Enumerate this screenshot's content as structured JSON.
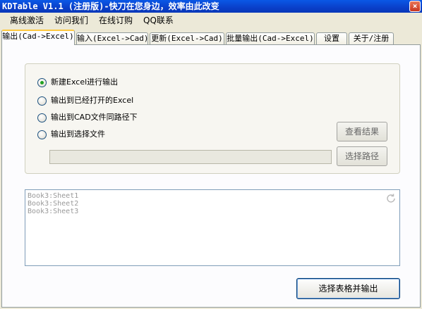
{
  "window": {
    "title": "KDTable V1.1 (注册版)-快刀在您身边，效率由此改变",
    "close_label": "×"
  },
  "menu": [
    {
      "label": "离线激活"
    },
    {
      "label": "访问我们"
    },
    {
      "label": "在线订购"
    },
    {
      "label": "QQ联系"
    }
  ],
  "tabs": [
    {
      "label": "输出(Cad->Excel)",
      "active": true
    },
    {
      "label": "输入(Excel->Cad)"
    },
    {
      "label": "更新(Excel->Cad)"
    },
    {
      "label": "批量输出(Cad->Excel)"
    },
    {
      "label": "设置"
    },
    {
      "label": "关于/注册"
    }
  ],
  "output_options": {
    "options": [
      {
        "label": "新建Excel进行输出",
        "checked": true
      },
      {
        "label": "输出到已经打开的Excel",
        "checked": false
      },
      {
        "label": "输出到CAD文件同路径下",
        "checked": false
      },
      {
        "label": "输出到选择文件",
        "checked": false
      }
    ],
    "path_value": "",
    "view_result_label": "查看结果",
    "choose_path_label": "选择路径"
  },
  "sheets": [
    "Book3:Sheet1",
    "Book3:Sheet2",
    "Book3:Sheet3"
  ],
  "export_button_label": "选择表格并输出",
  "colors": {
    "title_bar": "#0a3fc9",
    "active_tab_accent": "#ffc83c",
    "radio_dot": "#21a121"
  }
}
